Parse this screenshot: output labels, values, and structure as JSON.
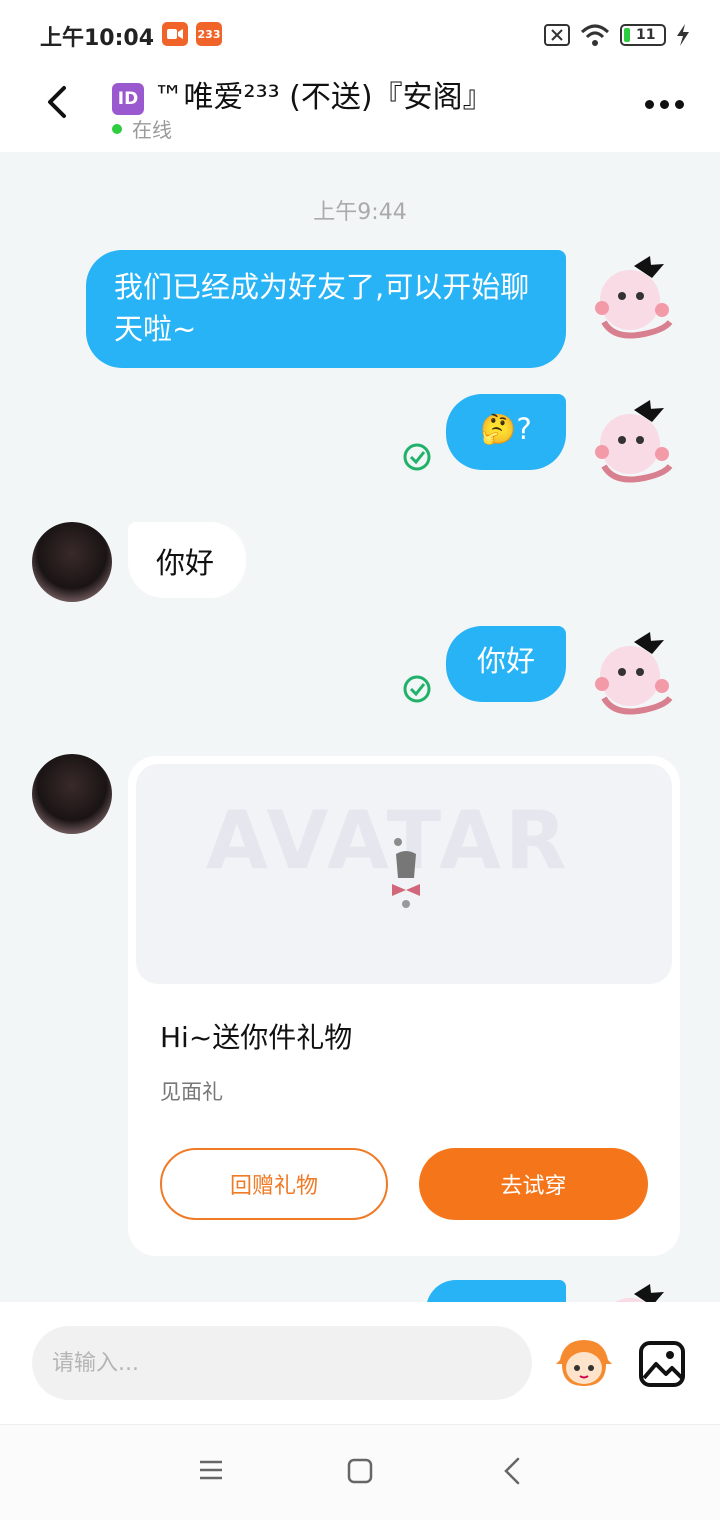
{
  "status_bar": {
    "time": "上午10:04",
    "app_badge": "233",
    "battery": "11"
  },
  "header": {
    "id_badge": "ID",
    "title": "™唯爱²³³ (不送)『安阁』",
    "status": "在线"
  },
  "chat": {
    "timestamp": "上午9:44",
    "messages": [
      {
        "from": "me",
        "text": "我们已经成为好友了,可以开始聊天啦~"
      },
      {
        "from": "me",
        "text": "🤔?"
      },
      {
        "from": "other",
        "text": "你好"
      },
      {
        "from": "me",
        "text": "你好"
      }
    ],
    "gift_card": {
      "watermark": "AVATAR",
      "title": "Hi~送你件礼物",
      "subtitle": "见面礼",
      "return_gift_label": "回赠礼物",
      "try_on_label": "去试穿"
    }
  },
  "input": {
    "placeholder": "请输入..."
  },
  "colors": {
    "bubble_out": "#27b3f5",
    "accent_orange": "#f5761a",
    "online_dot": "#2ecc40"
  }
}
